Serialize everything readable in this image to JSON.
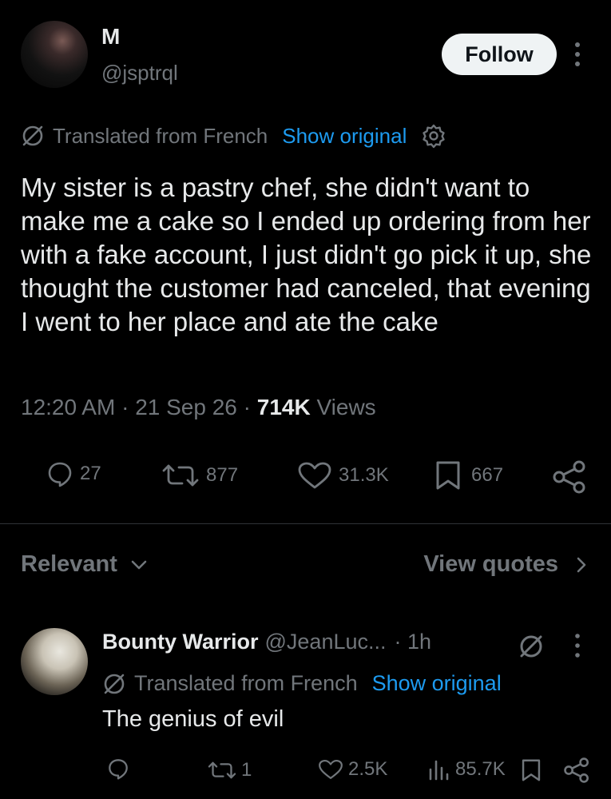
{
  "author": {
    "name": "M",
    "handle": "@jsptrql",
    "follow_label": "Follow"
  },
  "translation": {
    "label": "Translated from French",
    "show_original": "Show original"
  },
  "tweet": {
    "text": "My sister is a pastry chef, she didn't want to make me a cake so I ended up ordering from her with a fake account, I just didn't go pick it up, she thought the customer had canceled, that evening I went to her place and ate the cake",
    "time": "12:20 AM",
    "date": "21 Sep 26",
    "views_count": "714K",
    "views_label": "Views",
    "sep": "·"
  },
  "stats": {
    "replies": "27",
    "reposts": "877",
    "likes": "31.3K",
    "bookmarks": "667"
  },
  "sort": {
    "label": "Relevant",
    "quotes_label": "View quotes"
  },
  "reply": {
    "name": "Bounty Warrior",
    "handle": "@JeanLuc...",
    "time": "· 1h",
    "translation_label": "Translated from French",
    "show_original": "Show original",
    "text": "The genius of evil",
    "replies": "",
    "reposts": "1",
    "likes": "2.5K",
    "views": "85.7K"
  },
  "colors": {
    "background": "#000000",
    "text": "#e7e9ea",
    "muted": "#71767b",
    "link": "#1d9bf0",
    "divider": "#2f3336"
  }
}
